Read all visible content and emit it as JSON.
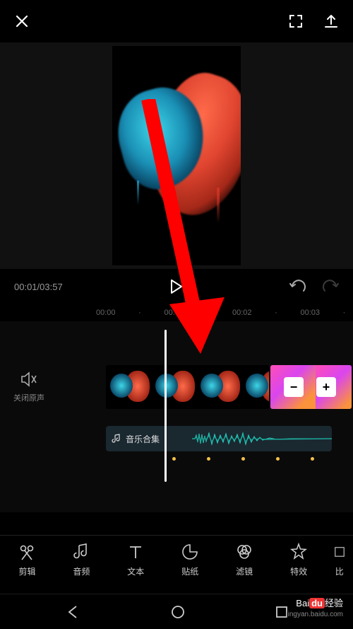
{
  "playback": {
    "current_time": "00:01",
    "total_time": "03:57",
    "separator": "/"
  },
  "timeline": {
    "ruler": [
      "00:00",
      "00:01",
      "00:02",
      "00:03"
    ],
    "mute_label": "关闭原声",
    "audio_label": "音乐合集"
  },
  "toolbar": {
    "items": [
      {
        "label": "剪辑"
      },
      {
        "label": "音频"
      },
      {
        "label": "文本"
      },
      {
        "label": "贴纸"
      },
      {
        "label": "滤镜"
      },
      {
        "label": "特效"
      },
      {
        "label": "比"
      }
    ]
  },
  "clip_buttons": {
    "minus": "−",
    "plus": "+"
  },
  "watermark": {
    "brand_prefix": "Bai",
    "brand_box": "du",
    "brand_suffix": "经验",
    "url": "jingyan.baidu.com"
  }
}
